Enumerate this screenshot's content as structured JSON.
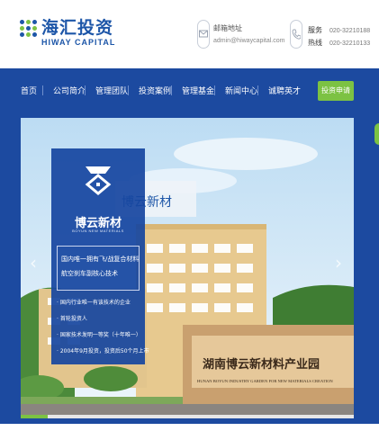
{
  "brand": {
    "name_cn": "海汇投资",
    "name_en": "HIWAY CAPITAL",
    "color": "#1d56a8"
  },
  "contact": {
    "email_label": "邮箱地址",
    "email": "admin@hiwaycapital.com",
    "service_label": "服务",
    "service_phone": "020-32210188",
    "hotline_label": "热线",
    "hotline_phone": "020-32210133"
  },
  "nav": {
    "items": [
      "首页",
      "公司简介",
      "管理团队",
      "投资案例",
      "管理基金",
      "新闻中心",
      "诚聘英才"
    ],
    "cta": "投资申请",
    "bg_color": "#1c4aa0",
    "cta_color": "#7cc243"
  },
  "banner": {
    "building_sign": "博云新材",
    "gate_sign_cn": "湖南博云新材料产业园",
    "gate_sign_en": "HUNAN BOYUN INDUSTRY GARDEN FOR NEW MATERIALS CREATION",
    "progress": 0.08,
    "card": {
      "brand_cn": "博云新材",
      "brand_en": "BOYUN NEW MATERIALS",
      "box_lines": [
        "国内唯一拥有飞/战复合材料",
        "航空刹车副核心技术"
      ],
      "points": [
        "· 国内行业唯一有该技术的企业",
        "· 首轮投资人",
        "· 国家技术发明一等奖（十年唯一）",
        "· 2004年9月投资，投资后50个月上市"
      ]
    }
  },
  "icons": {
    "mail": "mail-icon",
    "phone": "phone-icon",
    "prev": "chevron-left-icon",
    "next": "chevron-right-icon"
  }
}
